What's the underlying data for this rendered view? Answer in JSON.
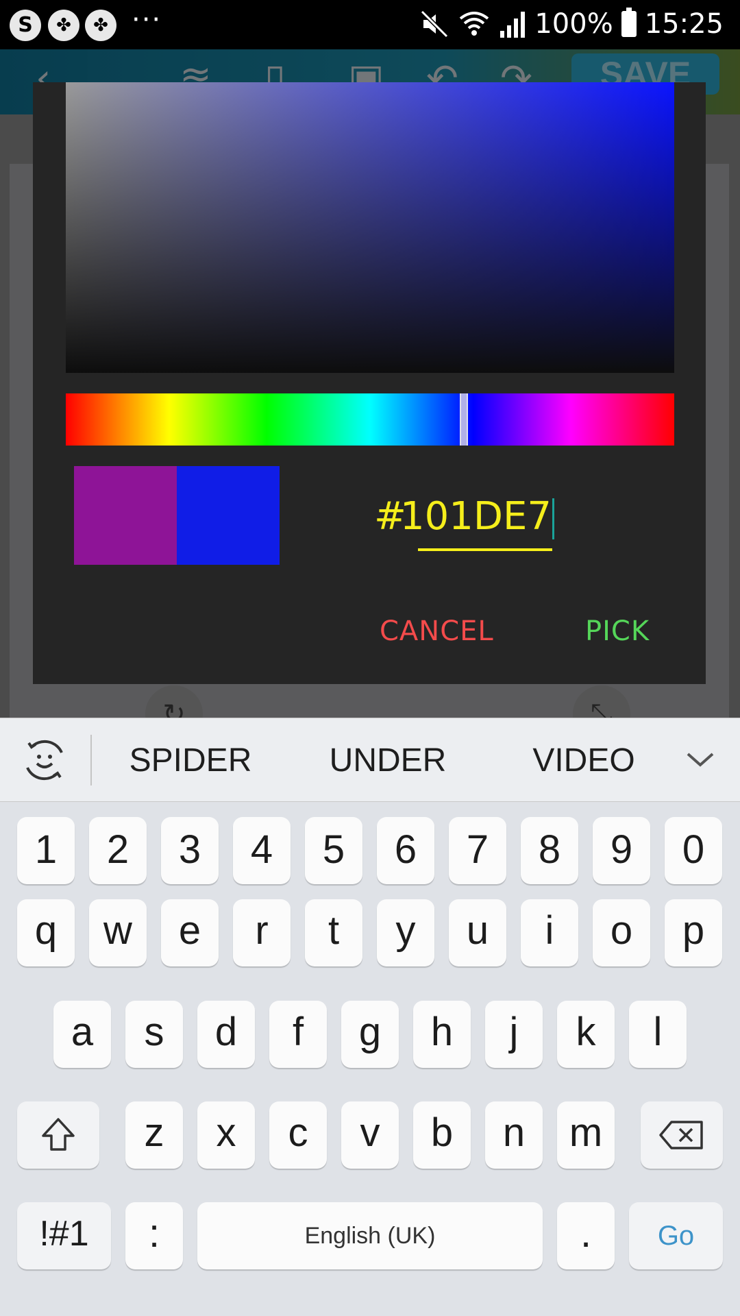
{
  "status_bar": {
    "battery_percent": "100%",
    "time": "15:25",
    "more": "···"
  },
  "app": {
    "save_label": "SAVE"
  },
  "color_picker": {
    "hex_prefix": "#",
    "hex_value": "101DE7",
    "hue_fraction": 0.654,
    "old_color": "#8e1497",
    "new_color": "#101de7",
    "hue_color": "#0b14ff",
    "cancel_label": "CANCEL",
    "pick_label": "PICK"
  },
  "suggestions": {
    "words": [
      "SPIDER",
      "UNDER",
      "VIDEO"
    ]
  },
  "keyboard": {
    "row_numbers": [
      "1",
      "2",
      "3",
      "4",
      "5",
      "6",
      "7",
      "8",
      "9",
      "0"
    ],
    "row_top": [
      "q",
      "w",
      "e",
      "r",
      "t",
      "y",
      "u",
      "i",
      "o",
      "p"
    ],
    "row_middle": [
      "a",
      "s",
      "d",
      "f",
      "g",
      "h",
      "j",
      "k",
      "l"
    ],
    "row_bottom": [
      "z",
      "x",
      "c",
      "v",
      "b",
      "n",
      "m"
    ],
    "symbols_label": "!#1",
    "colon_label": ":",
    "space_label": "English (UK)",
    "period_label": ".",
    "go_label": "Go"
  }
}
